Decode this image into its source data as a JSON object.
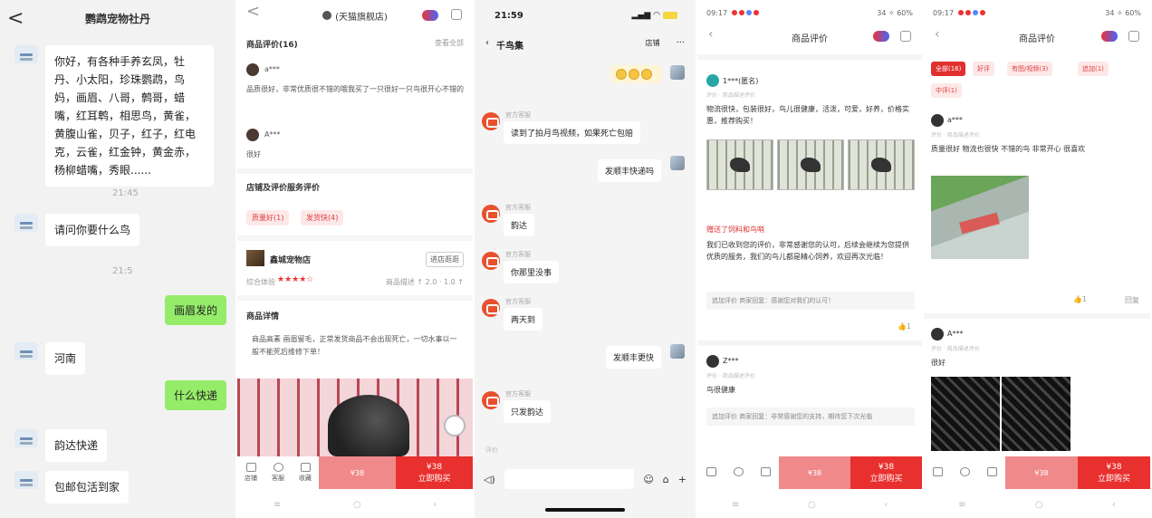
{
  "panel1": {
    "title": "鹦鹉宠物社丹",
    "back": "<",
    "msg1": "你好，有各种手养玄凤，牡丹、小太阳，珍珠鹦鹉，鸟妈，画眉、八哥，鹩哥，蜡嘴，红耳鹎，相思鸟，黄雀，黄腹山雀，贝子，红子，红电克，云雀，红金钟，黄金赤，杨柳蜡嘴，秀眼......",
    "ts1": "21:45",
    "msg2": "请问你要什么鸟",
    "ts2": "21:5",
    "reply1": "画眉发的",
    "msg3": "河南",
    "reply2": "什么快递",
    "msg4": "韵达快递",
    "msg5": "包邮包活到家"
  },
  "panel2": {
    "back": "<",
    "title": "(天猫旗舰店)",
    "section1": "商品评价(16)",
    "section1_right": "查看全部",
    "user1": "a***",
    "review1": "品质很好，非常优质很不错的哦我买了一只很好一只鸟很开心不错的",
    "user2": "A***",
    "review2": "很好",
    "section2": "店铺及评价服务评价",
    "tag1": "质量好(1)",
    "tag2": "发货快(4)",
    "shop_name": "鑫城宠物店",
    "shop_btn": "进店逛逛",
    "shop_meta": "综合体验",
    "stars": "★★★★☆",
    "shop_meta_right": "商品描述 ↑ 2.0 · 1.0 ↑",
    "section3": "商品详情",
    "detail": "商品高素 画眉留毛，正常发货商品不会出现死亡，一切水事以一般不能死后维修下单！",
    "price": "¥38",
    "buy_label": "立即购买",
    "icons": [
      "店铺",
      "客服",
      "收藏"
    ]
  },
  "panel3": {
    "time": "21:59",
    "contact": "千鸟集",
    "header_right": "店铺",
    "more": "···",
    "b1": "读到了拍月鸟视频，如果死亡包赔",
    "r1": "发顺丰快递吗",
    "b2": "韵达",
    "b3": "你那里没事",
    "b4": "两天到",
    "r2": "发顺丰更快",
    "b5": "只发韵达",
    "label": "官方客服",
    "bottom_hint": "评价"
  },
  "panel4": {
    "status_time": "09:17",
    "status_right": "34 ✧ 60%",
    "title": "商品评价",
    "user1": "1***(匿名)",
    "meta1": "评价 · 商品描述评价",
    "text1": "物流很快，包装很好，鸟儿很健康，活泼，可爱，好养，价格实惠，推荐购买！",
    "red_line": "赠送了饲料和鸟哨",
    "text2": "我们已收到您的评价，非常感谢您的认可，后续会继续为您提供优质的服务，我们的鸟儿都是精心饲养，欢迎再次光临！",
    "fold1": "追加评价 商家回复：感谢您对我们的认可！",
    "likes1": "1",
    "user2": "Z***",
    "meta2": "评价 · 商品描述评价",
    "text3": "鸟很健康",
    "fold2": "追加评价 商家回复：非常感谢您的支持，期待您下次光临",
    "price": "¥38",
    "buy_label": "立即购买"
  },
  "panel5": {
    "status_time": "09:17",
    "status_right": "34 ✧ 60%",
    "title": "商品评价",
    "filters": [
      "全部(16)",
      "好评",
      "有图/视频(3)",
      "追加(1)",
      "中评(1)"
    ],
    "user1": "a***",
    "meta1": "评价 · 商品描述评价",
    "text1": "质量很好 物流也很快 不错的鸟 非常开心 很喜欢",
    "likes": "1",
    "reply": "回复",
    "user2": "A***",
    "meta2": "评价 · 商品描述评价",
    "text2": "很好",
    "price": "¥38",
    "buy_label": "立即购买"
  },
  "colors": {
    "wechat_green": "#95ec69",
    "taobao_red": "#e8302e",
    "light_red": "#f08a8a",
    "chat_bg": "#f2f2f2"
  }
}
